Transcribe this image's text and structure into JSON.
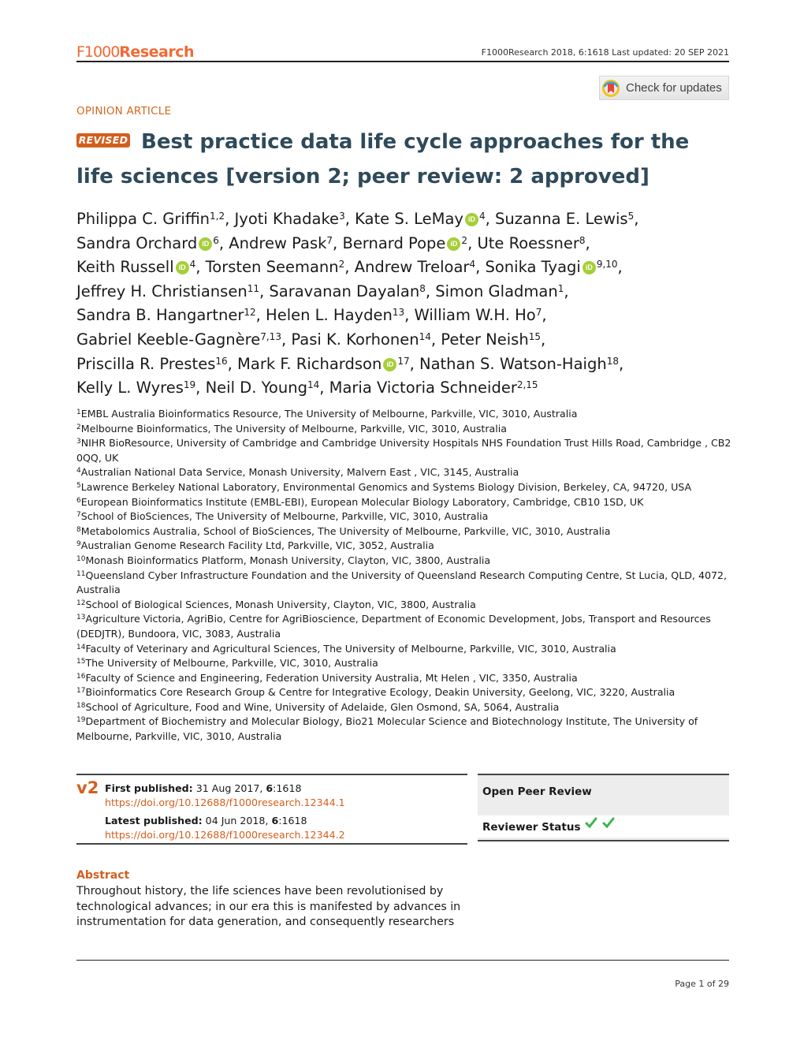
{
  "header": {
    "logo_prefix": "F1000",
    "logo_suffix": "Research",
    "citation": "F1000Research 2018, 6:1618 Last updated: 20 SEP 2021"
  },
  "check_updates": {
    "label": "Check for updates",
    "icon": "crossmark-icon"
  },
  "article": {
    "type": "OPINION ARTICLE",
    "badge": "REVISED",
    "title": "Best practice data life cycle approaches for the life sciences",
    "version_note": "[version 2; peer review: 2 approved]"
  },
  "authors": [
    {
      "name": "Philippa C. Griffin",
      "affs": "1,2",
      "orcid": false
    },
    {
      "name": "Jyoti Khadake",
      "affs": "3",
      "orcid": false
    },
    {
      "name": "Kate S. LeMay",
      "affs": "4",
      "orcid": true
    },
    {
      "name": "Suzanna E. Lewis",
      "affs": "5",
      "orcid": false
    },
    {
      "name": "Sandra Orchard",
      "affs": "6",
      "orcid": true
    },
    {
      "name": "Andrew Pask",
      "affs": "7",
      "orcid": false
    },
    {
      "name": "Bernard Pope",
      "affs": "2",
      "orcid": true
    },
    {
      "name": "Ute Roessner",
      "affs": "8",
      "orcid": false
    },
    {
      "name": "Keith Russell",
      "affs": "4",
      "orcid": true
    },
    {
      "name": "Torsten Seemann",
      "affs": "2",
      "orcid": false
    },
    {
      "name": "Andrew Treloar",
      "affs": "4",
      "orcid": false
    },
    {
      "name": "Sonika Tyagi",
      "affs": "9,10",
      "orcid": true
    },
    {
      "name": "Jeffrey H. Christiansen",
      "affs": "11",
      "orcid": false
    },
    {
      "name": "Saravanan Dayalan",
      "affs": "8",
      "orcid": false
    },
    {
      "name": "Simon Gladman",
      "affs": "1",
      "orcid": false
    },
    {
      "name": "Sandra B. Hangartner",
      "affs": "12",
      "orcid": false
    },
    {
      "name": "Helen L. Hayden",
      "affs": "13",
      "orcid": false
    },
    {
      "name": "William W.H. Ho",
      "affs": "7",
      "orcid": false
    },
    {
      "name": "Gabriel Keeble-Gagnère",
      "affs": "7,13",
      "orcid": false
    },
    {
      "name": "Pasi K. Korhonen",
      "affs": "14",
      "orcid": false
    },
    {
      "name": "Peter Neish",
      "affs": "15",
      "orcid": false
    },
    {
      "name": "Priscilla R. Prestes",
      "affs": "16",
      "orcid": false
    },
    {
      "name": "Mark F. Richardson",
      "affs": "17",
      "orcid": true
    },
    {
      "name": "Nathan S. Watson-Haigh",
      "affs": "18",
      "orcid": false
    },
    {
      "name": "Kelly L. Wyres",
      "affs": "19",
      "orcid": false
    },
    {
      "name": "Neil D. Young",
      "affs": "14",
      "orcid": false
    },
    {
      "name": "Maria Victoria Schneider",
      "affs": "2,15",
      "orcid": false
    }
  ],
  "orcid_label": "iD",
  "affiliations": [
    {
      "num": "1",
      "text": "EMBL Australia Bioinformatics Resource, The University of Melbourne, Parkville, VIC, 3010, Australia"
    },
    {
      "num": "2",
      "text": "Melbourne Bioinformatics, The University of Melbourne, Parkville, VIC, 3010, Australia"
    },
    {
      "num": "3",
      "text": "NIHR BioResource, University of Cambridge and Cambridge University Hospitals NHS Foundation Trust Hills Road, Cambridge , CB2 0QQ, UK"
    },
    {
      "num": "4",
      "text": "Australian National Data Service, Monash University, Malvern East , VIC, 3145, Australia"
    },
    {
      "num": "5",
      "text": "Lawrence Berkeley National Laboratory, Environmental Genomics and Systems Biology Division, Berkeley, CA, 94720, USA"
    },
    {
      "num": "6",
      "text": "European Bioinformatics Institute (EMBL-EBI), European Molecular Biology Laboratory, Cambridge, CB10 1SD, UK"
    },
    {
      "num": "7",
      "text": "School of BioSciences, The University of Melbourne, Parkville, VIC, 3010, Australia"
    },
    {
      "num": "8",
      "text": "Metabolomics Australia, School of BioSciences, The University of Melbourne, Parkville, VIC, 3010, Australia"
    },
    {
      "num": "9",
      "text": "Australian Genome Research Facility Ltd, Parkville, VIC, 3052, Australia"
    },
    {
      "num": "10",
      "text": "Monash Bioinformatics Platform, Monash University, Clayton, VIC, 3800, Australia"
    },
    {
      "num": "11",
      "text": "Queensland Cyber Infrastructure Foundation and the University of Queensland Research Computing Centre, St Lucia, QLD, 4072, Australia"
    },
    {
      "num": "12",
      "text": "School of Biological Sciences, Monash University, Clayton, VIC, 3800, Australia"
    },
    {
      "num": "13",
      "text": "Agriculture Victoria, AgriBio, Centre for AgriBioscience, Department of Economic Development, Jobs, Transport and Resources (DEDJTR), Bundoora, VIC, 3083, Australia"
    },
    {
      "num": "14",
      "text": "Faculty of Veterinary and Agricultural Sciences, The University of Melbourne, Parkville, VIC, 3010, Australia"
    },
    {
      "num": "15",
      "text": "The University of Melbourne, Parkville, VIC, 3010, Australia"
    },
    {
      "num": "16",
      "text": "Faculty of Science and Engineering, Federation University Australia, Mt Helen , VIC, 3350, Australia"
    },
    {
      "num": "17",
      "text": "Bioinformatics Core Research Group & Centre for Integrative Ecology, Deakin University, Geelong, VIC, 3220, Australia"
    },
    {
      "num": "18",
      "text": "School of Agriculture, Food and Wine, University of Adelaide, Glen Osmond, SA, 5064, Australia"
    },
    {
      "num": "19",
      "text": "Department of Biochemistry and Molecular Biology, Bio21 Molecular Science and Biotechnology Institute, The University of Melbourne, Parkville, VIC, 3010, Australia"
    }
  ],
  "publication": {
    "version": "v2",
    "first_label": "First published:",
    "first_date": " 31 Aug 2017, ",
    "first_vol": "6",
    "first_page": ":1618",
    "first_doi": "https://doi.org/10.12688/f1000research.12344.1",
    "latest_label": "Latest published:",
    "latest_date": " 04 Jun 2018, ",
    "latest_vol": "6",
    "latest_page": ":1618",
    "latest_doi": "https://doi.org/10.12688/f1000research.12344.2"
  },
  "peer_review": {
    "heading": "Open Peer Review",
    "status_label": "Reviewer Status",
    "approvals": 2
  },
  "abstract": {
    "heading": "Abstract",
    "text": "Throughout history, the life sciences have been revolutionised by technological advances; in our era this is manifested by advances in instrumentation for data generation, and consequently researchers"
  },
  "footer": {
    "page": "Page 1 of 29"
  },
  "colors": {
    "brand_orange": "#f06a35",
    "accent_orange": "#d35f1e",
    "title_slate": "#2f4a5a",
    "orcid_green": "#a6ce39",
    "check_green": "#3bb54a"
  }
}
